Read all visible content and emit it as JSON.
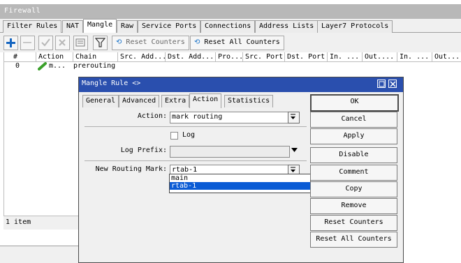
{
  "window": {
    "title": "Firewall"
  },
  "tabs": [
    "Filter Rules",
    "NAT",
    "Mangle",
    "Raw",
    "Service Ports",
    "Connections",
    "Address Lists",
    "Layer7 Protocols"
  ],
  "toolbar": {
    "reset_counters": "Reset Counters",
    "reset_all_counters": "Reset All Counters"
  },
  "table": {
    "headers": [
      "#",
      "Action",
      "Chain",
      "Src. Add...",
      "Dst. Add...",
      "Pro...",
      "Src. Port",
      "Dst. Port",
      "In. ...",
      "Out....",
      "In. ...",
      "Out...."
    ],
    "rows": [
      {
        "num": "0",
        "action": "m...",
        "chain": "prerouting"
      }
    ]
  },
  "status": {
    "count": "1 item"
  },
  "dialog": {
    "title": "Mangle Rule <>",
    "tabs": [
      "General",
      "Advanced",
      "Extra",
      "Action",
      "Statistics"
    ],
    "action_label": "Action:",
    "action_value": "mark routing",
    "log_label": "Log",
    "log_prefix_label": "Log Prefix:",
    "log_prefix_value": "",
    "routing_mark_label": "New Routing Mark:",
    "routing_mark_value": "rtab-1",
    "routing_mark_options": [
      "main",
      "rtab-1"
    ],
    "buttons": [
      "OK",
      "Cancel",
      "Apply",
      "Disable",
      "Comment",
      "Copy",
      "Remove",
      "Reset Counters",
      "Reset All Counters"
    ]
  },
  "colors": {
    "accent": "#2a4fae",
    "selection": "#0a5bd5",
    "add_icon": "#1565c0",
    "action_icon": "#3aa02a"
  }
}
